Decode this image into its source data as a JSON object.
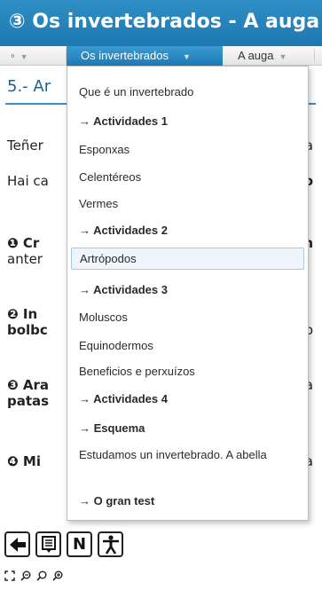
{
  "title": "③ Os invertebrados - A auga",
  "nav": {
    "tab_home": "◦",
    "tab_invertebrados": "Os invertebrados",
    "tab_auga": "A auga",
    "caret": "▼"
  },
  "page": {
    "heading": "5.- Ar",
    "lines_left": [
      "Teñer",
      "Hai ca",
      "❶ Cr",
      "anter",
      "❷ In",
      "bolbc",
      "❸ Ara",
      "patas",
      "❹ Mi"
    ],
    "lines_right": [
      "a",
      "o",
      "n",
      "o",
      "a",
      "a"
    ]
  },
  "menu": {
    "items": [
      {
        "label": "Que é un invertebrado",
        "type": "item"
      },
      {
        "label": "→ Actividades 1",
        "type": "sub"
      },
      {
        "label": "Esponxas",
        "type": "item"
      },
      {
        "label": "Celentéreos",
        "type": "item"
      },
      {
        "label": "Vermes",
        "type": "item"
      },
      {
        "label": "→ Actividades 2",
        "type": "sub"
      },
      {
        "label": "Artrópodos",
        "type": "item",
        "highlighted": true
      },
      {
        "label": "→ Actividades 3",
        "type": "sub"
      },
      {
        "label": "Moluscos",
        "type": "item"
      },
      {
        "label": "Equinodermos",
        "type": "item"
      },
      {
        "label": "Beneficios e perxuízos",
        "type": "item"
      },
      {
        "label": "→ Actividades 4",
        "type": "sub"
      },
      {
        "label": "→ Esquema",
        "type": "sub"
      },
      {
        "label": "Estudamos un invertebrado. A abella",
        "type": "item"
      },
      {
        "label": "→ O gran test",
        "type": "sub"
      }
    ]
  },
  "toolbar": {
    "back_icon": "arrow-left-icon",
    "notes_icon": "notes-icon",
    "n_label": "N",
    "accessibility_icon": "accessibility-icon",
    "zoom_icons": [
      "fit-icon",
      "zoom-out-icon",
      "zoom-reset-icon",
      "zoom-in-icon"
    ]
  },
  "colors": {
    "titlebar": "#1f78b0",
    "active_tab": "#2a8cc6",
    "heading": "#1f5f8b",
    "highlight_border": "#a8c8e4",
    "highlight_bg": "#eef5fc"
  }
}
